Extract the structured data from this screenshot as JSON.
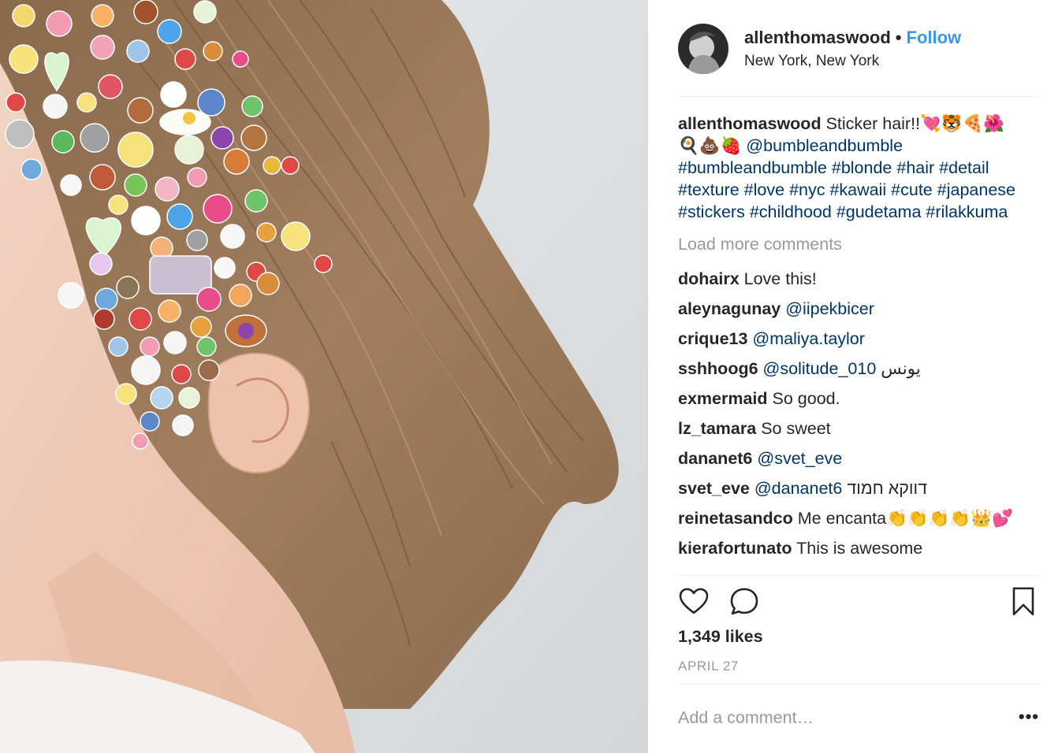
{
  "post": {
    "username": "allenthomaswood",
    "dot": "•",
    "follow_label": "Follow",
    "location": "New York, New York",
    "caption": {
      "username": "allenthomaswood",
      "text": "Sticker hair!!",
      "emoji_line1": "💘🐯🍕🌺",
      "emoji_line2": "🍳💩🍓",
      "tags": [
        "@bumbleandbumble",
        "#bumbleandbumble",
        "#blonde",
        "#hair",
        "#detail",
        "#texture",
        "#love",
        "#nyc",
        "#kawaii",
        "#cute",
        "#japanese",
        "#stickers",
        "#childhood",
        "#gudetama",
        "#rilakkuma"
      ]
    },
    "load_more": "Load more comments",
    "comments": [
      {
        "user": "dohairx",
        "text": "Love this!",
        "mention": "",
        "suffix": ""
      },
      {
        "user": "aleynagunay",
        "text": "",
        "mention": "@iipekbicer",
        "suffix": ""
      },
      {
        "user": "crique13",
        "text": "",
        "mention": "@maliya.taylor",
        "suffix": ""
      },
      {
        "user": "sshhoog6",
        "text": "",
        "mention": "@solitude_010",
        "suffix": "يونس"
      },
      {
        "user": "exmermaid",
        "text": "So good.",
        "mention": "",
        "suffix": ""
      },
      {
        "user": "lz_tamara",
        "text": "So sweet",
        "mention": "",
        "suffix": ""
      },
      {
        "user": "dananet6",
        "text": "",
        "mention": "@svet_eve",
        "suffix": ""
      },
      {
        "user": "svet_eve",
        "text": "",
        "mention": "@dananet6",
        "suffix": "דווקא חמוד"
      },
      {
        "user": "reinetasandco",
        "text": "Me encanta👏👏👏👏👑💕",
        "mention": "",
        "suffix": ""
      },
      {
        "user": "kierafortunato",
        "text": "This is awesome",
        "mention": "",
        "suffix": ""
      }
    ],
    "icons": {
      "like": "heart-icon",
      "comment": "comment-bubble-icon",
      "save": "bookmark-icon",
      "more": "more-options-icon"
    },
    "likes": "1,349 likes",
    "date": "APRIL 27",
    "add_comment_placeholder": "Add a comment…",
    "more_label": "•••"
  }
}
